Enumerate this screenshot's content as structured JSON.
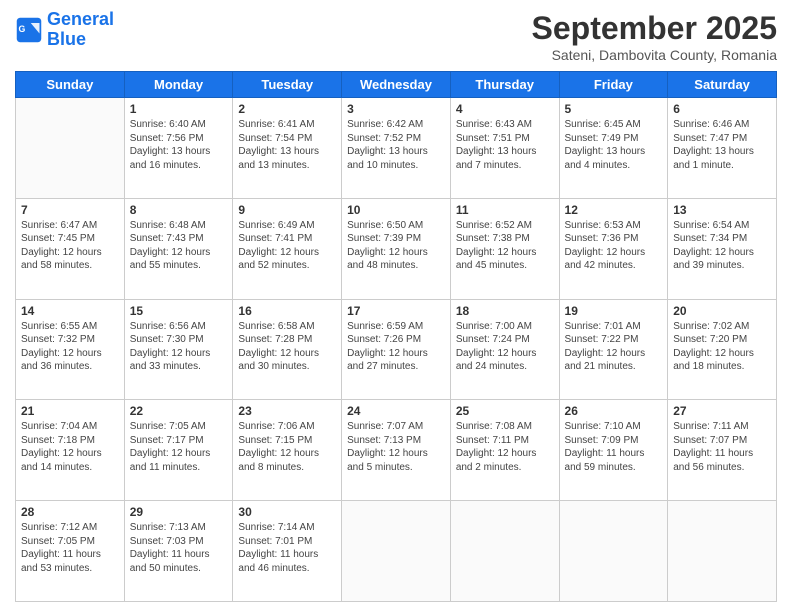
{
  "header": {
    "logo_line1": "General",
    "logo_line2": "Blue",
    "title": "September 2025",
    "subtitle": "Sateni, Dambovita County, Romania"
  },
  "columns": [
    "Sunday",
    "Monday",
    "Tuesday",
    "Wednesday",
    "Thursday",
    "Friday",
    "Saturday"
  ],
  "weeks": [
    [
      {
        "day": "",
        "sunrise": "",
        "sunset": "",
        "daylight": ""
      },
      {
        "day": "1",
        "sunrise": "Sunrise: 6:40 AM",
        "sunset": "Sunset: 7:56 PM",
        "daylight": "Daylight: 13 hours and 16 minutes."
      },
      {
        "day": "2",
        "sunrise": "Sunrise: 6:41 AM",
        "sunset": "Sunset: 7:54 PM",
        "daylight": "Daylight: 13 hours and 13 minutes."
      },
      {
        "day": "3",
        "sunrise": "Sunrise: 6:42 AM",
        "sunset": "Sunset: 7:52 PM",
        "daylight": "Daylight: 13 hours and 10 minutes."
      },
      {
        "day": "4",
        "sunrise": "Sunrise: 6:43 AM",
        "sunset": "Sunset: 7:51 PM",
        "daylight": "Daylight: 13 hours and 7 minutes."
      },
      {
        "day": "5",
        "sunrise": "Sunrise: 6:45 AM",
        "sunset": "Sunset: 7:49 PM",
        "daylight": "Daylight: 13 hours and 4 minutes."
      },
      {
        "day": "6",
        "sunrise": "Sunrise: 6:46 AM",
        "sunset": "Sunset: 7:47 PM",
        "daylight": "Daylight: 13 hours and 1 minute."
      }
    ],
    [
      {
        "day": "7",
        "sunrise": "Sunrise: 6:47 AM",
        "sunset": "Sunset: 7:45 PM",
        "daylight": "Daylight: 12 hours and 58 minutes."
      },
      {
        "day": "8",
        "sunrise": "Sunrise: 6:48 AM",
        "sunset": "Sunset: 7:43 PM",
        "daylight": "Daylight: 12 hours and 55 minutes."
      },
      {
        "day": "9",
        "sunrise": "Sunrise: 6:49 AM",
        "sunset": "Sunset: 7:41 PM",
        "daylight": "Daylight: 12 hours and 52 minutes."
      },
      {
        "day": "10",
        "sunrise": "Sunrise: 6:50 AM",
        "sunset": "Sunset: 7:39 PM",
        "daylight": "Daylight: 12 hours and 48 minutes."
      },
      {
        "day": "11",
        "sunrise": "Sunrise: 6:52 AM",
        "sunset": "Sunset: 7:38 PM",
        "daylight": "Daylight: 12 hours and 45 minutes."
      },
      {
        "day": "12",
        "sunrise": "Sunrise: 6:53 AM",
        "sunset": "Sunset: 7:36 PM",
        "daylight": "Daylight: 12 hours and 42 minutes."
      },
      {
        "day": "13",
        "sunrise": "Sunrise: 6:54 AM",
        "sunset": "Sunset: 7:34 PM",
        "daylight": "Daylight: 12 hours and 39 minutes."
      }
    ],
    [
      {
        "day": "14",
        "sunrise": "Sunrise: 6:55 AM",
        "sunset": "Sunset: 7:32 PM",
        "daylight": "Daylight: 12 hours and 36 minutes."
      },
      {
        "day": "15",
        "sunrise": "Sunrise: 6:56 AM",
        "sunset": "Sunset: 7:30 PM",
        "daylight": "Daylight: 12 hours and 33 minutes."
      },
      {
        "day": "16",
        "sunrise": "Sunrise: 6:58 AM",
        "sunset": "Sunset: 7:28 PM",
        "daylight": "Daylight: 12 hours and 30 minutes."
      },
      {
        "day": "17",
        "sunrise": "Sunrise: 6:59 AM",
        "sunset": "Sunset: 7:26 PM",
        "daylight": "Daylight: 12 hours and 27 minutes."
      },
      {
        "day": "18",
        "sunrise": "Sunrise: 7:00 AM",
        "sunset": "Sunset: 7:24 PM",
        "daylight": "Daylight: 12 hours and 24 minutes."
      },
      {
        "day": "19",
        "sunrise": "Sunrise: 7:01 AM",
        "sunset": "Sunset: 7:22 PM",
        "daylight": "Daylight: 12 hours and 21 minutes."
      },
      {
        "day": "20",
        "sunrise": "Sunrise: 7:02 AM",
        "sunset": "Sunset: 7:20 PM",
        "daylight": "Daylight: 12 hours and 18 minutes."
      }
    ],
    [
      {
        "day": "21",
        "sunrise": "Sunrise: 7:04 AM",
        "sunset": "Sunset: 7:18 PM",
        "daylight": "Daylight: 12 hours and 14 minutes."
      },
      {
        "day": "22",
        "sunrise": "Sunrise: 7:05 AM",
        "sunset": "Sunset: 7:17 PM",
        "daylight": "Daylight: 12 hours and 11 minutes."
      },
      {
        "day": "23",
        "sunrise": "Sunrise: 7:06 AM",
        "sunset": "Sunset: 7:15 PM",
        "daylight": "Daylight: 12 hours and 8 minutes."
      },
      {
        "day": "24",
        "sunrise": "Sunrise: 7:07 AM",
        "sunset": "Sunset: 7:13 PM",
        "daylight": "Daylight: 12 hours and 5 minutes."
      },
      {
        "day": "25",
        "sunrise": "Sunrise: 7:08 AM",
        "sunset": "Sunset: 7:11 PM",
        "daylight": "Daylight: 12 hours and 2 minutes."
      },
      {
        "day": "26",
        "sunrise": "Sunrise: 7:10 AM",
        "sunset": "Sunset: 7:09 PM",
        "daylight": "Daylight: 11 hours and 59 minutes."
      },
      {
        "day": "27",
        "sunrise": "Sunrise: 7:11 AM",
        "sunset": "Sunset: 7:07 PM",
        "daylight": "Daylight: 11 hours and 56 minutes."
      }
    ],
    [
      {
        "day": "28",
        "sunrise": "Sunrise: 7:12 AM",
        "sunset": "Sunset: 7:05 PM",
        "daylight": "Daylight: 11 hours and 53 minutes."
      },
      {
        "day": "29",
        "sunrise": "Sunrise: 7:13 AM",
        "sunset": "Sunset: 7:03 PM",
        "daylight": "Daylight: 11 hours and 50 minutes."
      },
      {
        "day": "30",
        "sunrise": "Sunrise: 7:14 AM",
        "sunset": "Sunset: 7:01 PM",
        "daylight": "Daylight: 11 hours and 46 minutes."
      },
      {
        "day": "",
        "sunrise": "",
        "sunset": "",
        "daylight": ""
      },
      {
        "day": "",
        "sunrise": "",
        "sunset": "",
        "daylight": ""
      },
      {
        "day": "",
        "sunrise": "",
        "sunset": "",
        "daylight": ""
      },
      {
        "day": "",
        "sunrise": "",
        "sunset": "",
        "daylight": ""
      }
    ]
  ]
}
